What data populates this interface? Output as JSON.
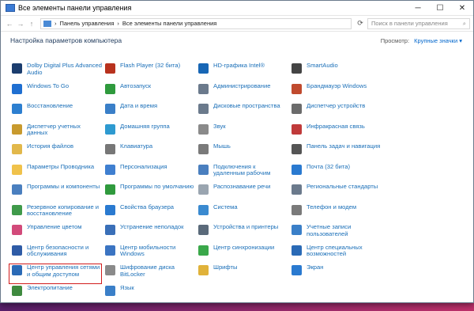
{
  "window": {
    "title": "Все элементы панели управления"
  },
  "address": {
    "path1": "Панель управления",
    "path2": "Все элементы панели управления"
  },
  "search_placeholder": "Поиск в панели управления",
  "heading": "Настройка параметров компьютера",
  "viewby": {
    "label": "Просмотр:",
    "value": "Крупные значки ▾"
  },
  "columns": [
    [
      {
        "label": "Dolby Digital Plus Advanced Audio",
        "color": "#1b3d6e"
      },
      {
        "label": "Windows To Go",
        "color": "#1f6fd1"
      },
      {
        "label": "Восстановление",
        "color": "#2d7fd0"
      },
      {
        "label": "Диспетчер учетных данных",
        "color": "#c89a2e"
      },
      {
        "label": "История файлов",
        "color": "#e2b84b"
      },
      {
        "label": "Параметры Проводника",
        "color": "#f0c24b"
      },
      {
        "label": "Программы и компоненты",
        "color": "#4a7fbf"
      },
      {
        "label": "Резервное копирование и восстановление",
        "color": "#3f9a4a"
      },
      {
        "label": "Управление цветом",
        "color": "#d24a7a"
      },
      {
        "label": "Центр безопасности и обслуживания",
        "color": "#2e5ba6"
      },
      {
        "label": "Центр управления сетями и общим доступом",
        "color": "#2a6ab6",
        "highlight": true
      },
      {
        "label": "Электропитание",
        "color": "#3f8a3f"
      }
    ],
    [
      {
        "label": "Flash Player (32 бита)",
        "color": "#b8321e"
      },
      {
        "label": "Автозапуск",
        "color": "#2f9a3d"
      },
      {
        "label": "Дата и время",
        "color": "#3a7fc8"
      },
      {
        "label": "Домашняя группа",
        "color": "#2e9ad0"
      },
      {
        "label": "Клавиатура",
        "color": "#777777"
      },
      {
        "label": "Персонализация",
        "color": "#3f7fd0"
      },
      {
        "label": "Программы по умолчанию",
        "color": "#2f9a3d"
      },
      {
        "label": "Свойства браузера",
        "color": "#2a7ad0"
      },
      {
        "label": "Устранение неполадок",
        "color": "#3a6fb8"
      },
      {
        "label": "Центр мобильности Windows",
        "color": "#3b74c2"
      },
      {
        "label": "Шифрование диска BitLocker",
        "color": "#8a8a8a"
      },
      {
        "label": "Язык",
        "color": "#3a7fc8"
      }
    ],
    [
      {
        "label": "HD-графика Intel®",
        "color": "#1766b5"
      },
      {
        "label": "Администрирование",
        "color": "#6b7a8c"
      },
      {
        "label": "Дисковые пространства",
        "color": "#6b7a8c"
      },
      {
        "label": "Звук",
        "color": "#8a8a8a"
      },
      {
        "label": "Мышь",
        "color": "#7a7a7a"
      },
      {
        "label": "Подключения к удаленным рабочим",
        "color": "#4a7fbf"
      },
      {
        "label": "Распознавание речи",
        "color": "#9aa5b0"
      },
      {
        "label": "Система",
        "color": "#3a8ad0"
      },
      {
        "label": "Устройства и принтеры",
        "color": "#5a6a7a"
      },
      {
        "label": "Центр синхронизации",
        "color": "#3aa84a"
      },
      {
        "label": "Шрифты",
        "color": "#e0b23a"
      },
      {
        "label": "",
        "color": ""
      }
    ],
    [
      {
        "label": "SmartAudio",
        "color": "#444444"
      },
      {
        "label": "Брандмауэр Windows",
        "color": "#c04a2e"
      },
      {
        "label": "Диспетчер устройств",
        "color": "#6b6b6b"
      },
      {
        "label": "Инфракрасная связь",
        "color": "#c03a3a"
      },
      {
        "label": "Панель задач и навигация",
        "color": "#555555"
      },
      {
        "label": "Почта (32 бита)",
        "color": "#2a7ad0"
      },
      {
        "label": "Региональные стандарты",
        "color": "#6b7a8c"
      },
      {
        "label": "Телефон и модем",
        "color": "#7a7a7a"
      },
      {
        "label": "Учетные записи пользователей",
        "color": "#3a7fc8"
      },
      {
        "label": "Центр специальных возможностей",
        "color": "#2a6ab6"
      },
      {
        "label": "Экран",
        "color": "#2a7ad0"
      },
      {
        "label": "",
        "color": ""
      }
    ]
  ]
}
